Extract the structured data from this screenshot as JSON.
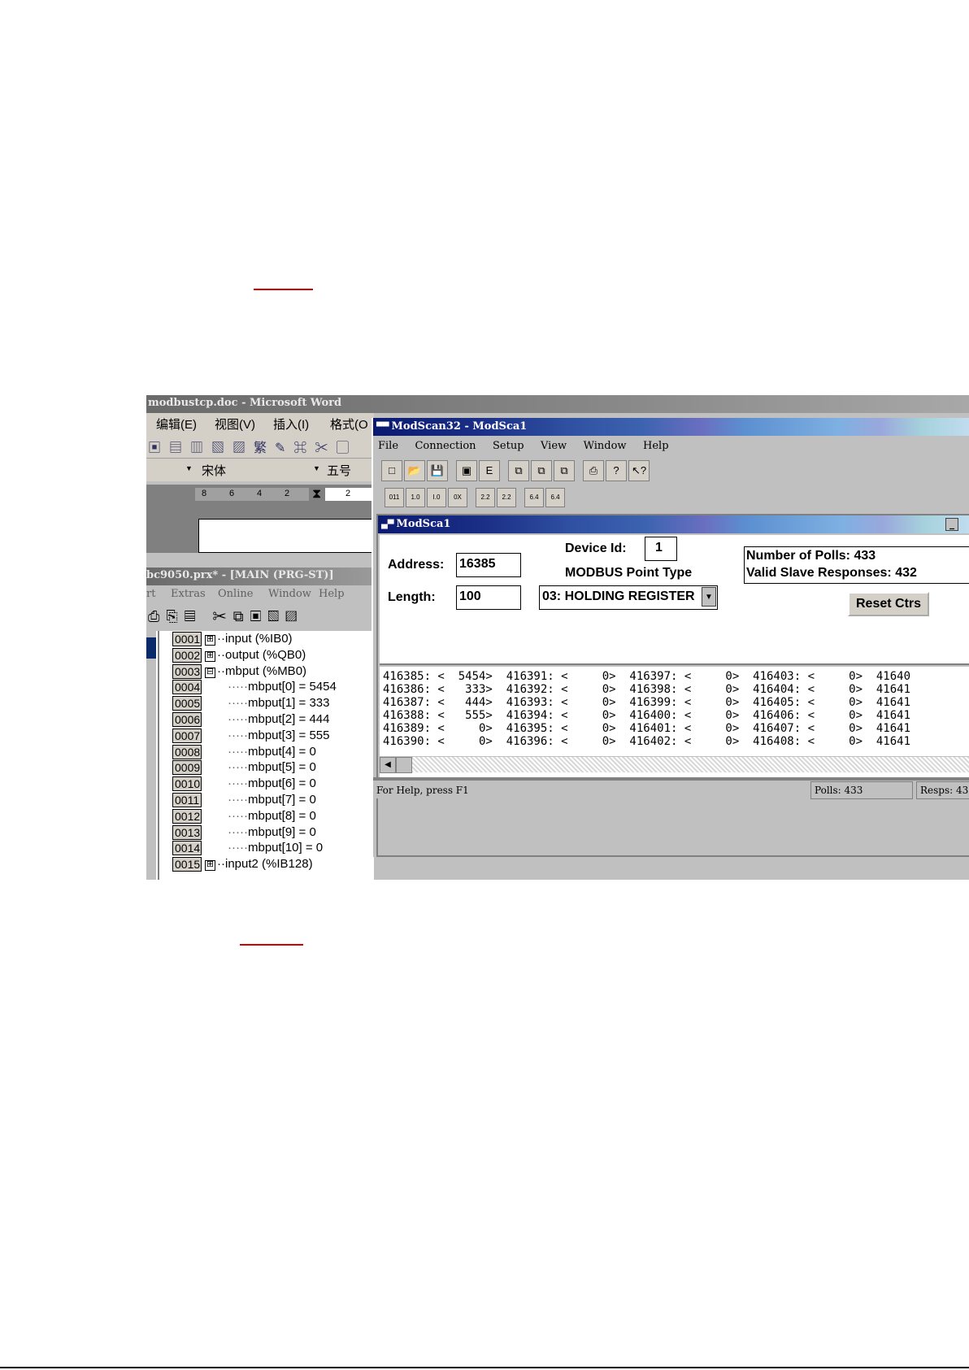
{
  "word": {
    "title": "modbustcp.doc - Microsoft Word",
    "menu": [
      "编辑(E)",
      "视图(V)",
      "插入(I)",
      "格式(O"
    ],
    "font_name": "宋体",
    "font_size": "五号",
    "ruler_ticks": [
      "8",
      "6",
      "4",
      "2",
      "2"
    ]
  },
  "prosys": {
    "title": "bc9050.prx* - [MAIN (PRG-ST)]",
    "menu": [
      "rt",
      "Extras",
      "Online",
      "Window",
      "Help"
    ],
    "tree": [
      {
        "num": "0001",
        "text": "input (%IB0)",
        "expander": "⊞",
        "indent": 0
      },
      {
        "num": "0002",
        "text": "output (%QB0)",
        "expander": "⊞",
        "indent": 0
      },
      {
        "num": "0003",
        "text": "mbput (%MB0)",
        "expander": "⊟",
        "indent": 0
      },
      {
        "num": "0004",
        "text": "mbput[0] = 5454",
        "expander": "",
        "indent": 1
      },
      {
        "num": "0005",
        "text": "mbput[1] = 333",
        "expander": "",
        "indent": 1
      },
      {
        "num": "0006",
        "text": "mbput[2] = 444",
        "expander": "",
        "indent": 1
      },
      {
        "num": "0007",
        "text": "mbput[3] = 555",
        "expander": "",
        "indent": 1
      },
      {
        "num": "0008",
        "text": "mbput[4] = 0",
        "expander": "",
        "indent": 1
      },
      {
        "num": "0009",
        "text": "mbput[5] = 0",
        "expander": "",
        "indent": 1
      },
      {
        "num": "0010",
        "text": "mbput[6] = 0",
        "expander": "",
        "indent": 1
      },
      {
        "num": "0011",
        "text": "mbput[7] = 0",
        "expander": "",
        "indent": 1
      },
      {
        "num": "0012",
        "text": "mbput[8] = 0",
        "expander": "",
        "indent": 1
      },
      {
        "num": "0013",
        "text": "mbput[9] = 0",
        "expander": "",
        "indent": 1
      },
      {
        "num": "0014",
        "text": "mbput[10] = 0",
        "expander": "",
        "indent": 1
      },
      {
        "num": "0015",
        "text": "input2 (%IB128)",
        "expander": "⊞",
        "indent": 0
      }
    ]
  },
  "modscan": {
    "title": "ModScan32 - ModSca1",
    "menu": [
      "File",
      "Connection",
      "Setup",
      "View",
      "Window",
      "Help"
    ],
    "toolbar1": [
      "□",
      "📂",
      "💾",
      "▣",
      "E",
      "⧉",
      "⧉",
      "⧉",
      "⎙",
      "?",
      "↖?"
    ],
    "toolbar2": [
      "011",
      "1.0",
      "I.0",
      "0X",
      "2.2",
      "2.2",
      "6.4",
      "6.4"
    ],
    "child_title": "ModSca1",
    "address_label": "Address:",
    "address_value": "16385",
    "length_label": "Length:",
    "length_value": "100",
    "device_id_label": "Device Id:",
    "device_id_value": "1",
    "point_type_label": "MODBUS Point Type",
    "point_type_value": "03: HOLDING REGISTER",
    "polls_text": "Number of Polls: 433",
    "responses_text": "Valid Slave Responses: 432",
    "reset_label": "Reset Ctrs",
    "data_lines": [
      "416385: <  5454>  416391: <     0>  416397: <     0>  416403: <     0>  41640",
      "416386: <   333>  416392: <     0>  416398: <     0>  416404: <     0>  41641",
      "416387: <   444>  416393: <     0>  416399: <     0>  416405: <     0>  41641",
      "416388: <   555>  416394: <     0>  416400: <     0>  416406: <     0>  41641",
      "416389: <     0>  416395: <     0>  416401: <     0>  416407: <     0>  41641",
      "416390: <     0>  416396: <     0>  416402: <     0>  416408: <     0>  41641"
    ],
    "status_help": "For Help, press F1",
    "status_polls": "Polls: 433",
    "status_resps": "Resps: 43"
  }
}
